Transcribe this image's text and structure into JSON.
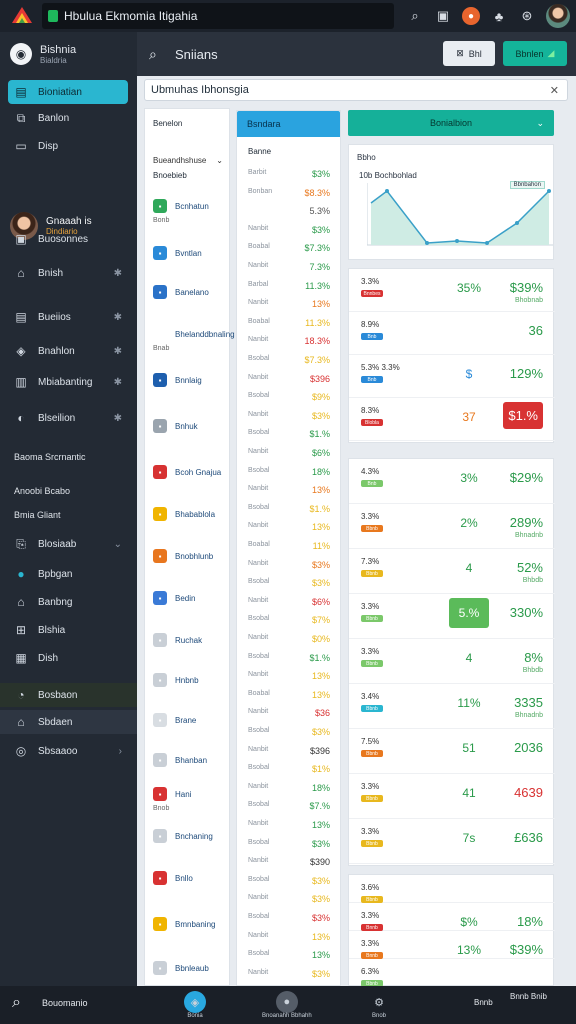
{
  "app": {
    "title": "Hbulua Ekmomia Itigahia"
  },
  "topbar": {
    "icons": [
      "search-icon",
      "calendar-icon",
      "orange-notification-icon",
      "tree-icon",
      "globe-icon"
    ]
  },
  "sidebar": {
    "brand_title": "Bishnia",
    "brand_sub": "Bialdria",
    "nav": [
      {
        "label": "Bioniatian",
        "icon": "dashboard-icon",
        "active": true
      },
      {
        "label": "Banlon",
        "icon": "book-icon"
      },
      {
        "label": "Disp",
        "icon": "card-icon"
      }
    ],
    "profile": {
      "name": "Gnaaah is",
      "status": "Dindiario"
    },
    "items": [
      {
        "label": "Buosonnes",
        "icon": "briefcase-icon"
      },
      {
        "label": "Bnish",
        "icon": "home-icon",
        "extra": "✱"
      },
      {
        "label": "Bueiios",
        "icon": "table-icon",
        "extra": "✱"
      },
      {
        "label": "Bnahlon",
        "icon": "tag-icon",
        "extra": "✱"
      },
      {
        "label": "Mbiabanting",
        "icon": "chart-icon",
        "extra": "✱"
      },
      {
        "label": "Blseilion",
        "icon": "shield-icon",
        "extra": "✱"
      }
    ],
    "section1": "Baoma Srcrnantic",
    "section2": "Anoobi Bcabo",
    "section3": "Bmia Gliant",
    "items2": [
      {
        "label": "Blosiaab",
        "icon": "doc-icon",
        "extra": "⌄"
      },
      {
        "label": "Bpbgan",
        "icon": "globe-icon"
      },
      {
        "label": "Banbng",
        "icon": "house-icon"
      },
      {
        "label": "Blshia",
        "icon": "gift-icon"
      },
      {
        "label": "Dish",
        "icon": "calc-icon"
      }
    ],
    "items3": [
      {
        "label": "Bosbaon",
        "icon": "refresh-icon"
      },
      {
        "label": "Sbdaen",
        "icon": "user-icon"
      },
      {
        "label": "Sbsaaoo",
        "icon": "settings-icon",
        "extra": "›"
      }
    ]
  },
  "header": {
    "search_label": "Sniians",
    "btn1": "Bhl",
    "btn2": "Bbnlen"
  },
  "main": {
    "address": "Ubmuhas Ibhonsgia",
    "col1": {
      "header": "Benelon",
      "dropdown": "Bueandhshuse",
      "sub": "Bnoebieb",
      "items": [
        {
          "label": "Bcnhatun",
          "color": "#2fa85a",
          "sub": "Bonb"
        },
        {
          "label": "Bvntlan",
          "color": "#2a8ad8"
        },
        {
          "label": "Banelano",
          "color": "#2a72c8"
        },
        {
          "label": "Bhelanddbnaling",
          "color": "",
          "sub": "Bnab"
        },
        {
          "label": "Bnnlaig",
          "color": "#1e5fae"
        },
        {
          "label": "Bnhuk",
          "color": "#9aa4ae"
        },
        {
          "label": "Bcoh Gnajua",
          "color": "#d73232"
        },
        {
          "label": "Bhabablola",
          "color": "#f0b400"
        },
        {
          "label": "Bnobhlunb",
          "color": "#e8761e"
        },
        {
          "label": "Bedin",
          "color": "#3a7ad6"
        },
        {
          "label": "Ruchak",
          "color": "#c9cfd6"
        },
        {
          "label": "Hnbnb",
          "color": "#c9cfd6"
        },
        {
          "label": "Brane",
          "color": "#d8dde2"
        },
        {
          "label": "Bhanban",
          "color": "#c9cfd6"
        },
        {
          "label": "Hani",
          "color": "#d83232",
          "sub": "Bnob"
        },
        {
          "label": "Bnchaning",
          "color": "#c9cfd6"
        },
        {
          "label": "Bnllo",
          "color": "#d83232"
        },
        {
          "label": "Bmnbaning",
          "color": "#f0b400"
        },
        {
          "label": "Bbnleaub",
          "color": "#c9cfd6"
        }
      ]
    },
    "col2": {
      "header": "Bsndara",
      "subhead": "Banne",
      "rows": [
        [
          "Barbit",
          "$3%",
          "#2a9a4a"
        ],
        [
          "Bonban",
          "$8.3%",
          "#e8781e"
        ],
        [
          "",
          "5.3%",
          "#555"
        ],
        [
          "Nanbit",
          "$3%",
          "#2a9a4a"
        ],
        [
          "Boabal",
          "$7.3%",
          "#2a9a4a"
        ],
        [
          "Nanbit",
          "7.3%",
          "#2a9a4a"
        ],
        [
          "Barbal",
          "11.3%",
          "#2a9a4a"
        ],
        [
          "Nanbit",
          "13%",
          "#e8781e"
        ],
        [
          "Boabal",
          "11.3%",
          "#e8b81e"
        ],
        [
          "Nanbit",
          "18.3%",
          "#d83232"
        ],
        [
          "Bsobal",
          "$7.3%",
          "#e8b81e"
        ],
        [
          "Nanbit",
          "$396",
          "#d83232"
        ],
        [
          "Bsobal",
          "$9%",
          "#e8b81e"
        ],
        [
          "Nanbit",
          "$3%",
          "#e8b81e"
        ],
        [
          "Bsobal",
          "$1.%",
          "#2a9a4a"
        ],
        [
          "Nanbit",
          "$6%",
          "#2a9a4a"
        ],
        [
          "Bsobal",
          "18%",
          "#2a9a4a"
        ],
        [
          "Nanbit",
          "13%",
          "#e8781e"
        ],
        [
          "Bsobal",
          "$1.%",
          "#e8b81e"
        ],
        [
          "Nanbit",
          "13%",
          "#e8b81e"
        ],
        [
          "Boabal",
          "11%",
          "#e8b81e"
        ],
        [
          "Nanbit",
          "$3%",
          "#e8781e"
        ],
        [
          "Bsobal",
          "$3%",
          "#e8b81e"
        ],
        [
          "Nanbit",
          "$6%",
          "#d83232"
        ],
        [
          "Bsobal",
          "$7%",
          "#e8b81e"
        ],
        [
          "Nanbit",
          "$0%",
          "#e8b81e"
        ],
        [
          "Bsobal",
          "$1.%",
          "#2a9a4a"
        ],
        [
          "Nanbit",
          "13%",
          "#e8b81e"
        ],
        [
          "Boabal",
          "13%",
          "#e8b81e"
        ],
        [
          "Nanbit",
          "$36",
          "#d83232"
        ],
        [
          "Bsobal",
          "$3%",
          "#e8b81e"
        ],
        [
          "Nanbit",
          "$396",
          "#333"
        ],
        [
          "Bsobal",
          "$1%",
          "#e8b81e"
        ],
        [
          "Nanbit",
          "18%",
          "#2a9a4a"
        ],
        [
          "Bsobal",
          "$7.%",
          "#2a9a4a"
        ],
        [
          "Nanbit",
          "13%",
          "#2a9a4a"
        ],
        [
          "Bsobal",
          "$3%",
          "#2a9a4a"
        ],
        [
          "Nanbit",
          "$390",
          "#333"
        ],
        [
          "Bsobal",
          "$3%",
          "#e8b81e"
        ],
        [
          "Nanbit",
          "$3%",
          "#e8b81e"
        ],
        [
          "Bsobal",
          "$3%",
          "#d83232"
        ],
        [
          "Nanbit",
          "13%",
          "#e8b81e"
        ],
        [
          "Bsobal",
          "13%",
          "#2a9a4a"
        ],
        [
          "Nanbit",
          "$3%",
          "#e8b81e"
        ]
      ]
    },
    "col3": {
      "header": "Bonialbion",
      "chart_label": "Bbho",
      "chart_title": "10b Bochbohlad",
      "legend": "Bbnbahon"
    },
    "panel1": [
      {
        "a": "3.3%",
        "badge": "Bnnbes",
        "bc": "#d83232",
        "m": "35%",
        "mc": "#2a9a4a",
        "r": "$39%",
        "rc": "#2a9a4a",
        "rs": "Bhobnab"
      },
      {
        "a": "8.9%",
        "badge": "Bnb",
        "bc": "#2a8ad8",
        "m": "",
        "mc": "#2a9a4a",
        "r": "36",
        "rc": "#2a9a4a",
        "rs": ""
      },
      {
        "a": "5.3% 3.3%",
        "badge": "Bnb",
        "bc": "#2a8ad8",
        "m": "$",
        "mc": "#2a8ad8",
        "r": "129%",
        "rc": "#2a9a4a",
        "rs": ""
      },
      {
        "a": "8.3%",
        "badge": "Blobla",
        "bc": "#d83232",
        "m": "37",
        "mc": "#e8781e",
        "r": "$1.%",
        "rc": "#fff",
        "box": "#d83232",
        "rs": ""
      }
    ],
    "panel2": [
      {
        "a": "4.3%",
        "badge": "Bnb",
        "bc": "#7bc86a",
        "m": "3%",
        "mc": "#2a9a4a",
        "r": "$29%",
        "rc": "#2a9a4a",
        "rs": ""
      },
      {
        "a": "3.3%",
        "badge": "Bbnb",
        "bc": "#e8781e",
        "m": "2%",
        "mc": "#2a9a4a",
        "r": "289%",
        "rc": "#2a9a4a",
        "rs": "Bhnadnb"
      },
      {
        "a": "7.3%",
        "badge": "Bbnb",
        "bc": "#e8b81e",
        "m": "4",
        "mc": "#2a9a4a",
        "r": "52%",
        "rc": "#2a9a4a",
        "rs": "Bhbdb"
      },
      {
        "a": "3.3%",
        "badge": "Bbnb",
        "bc": "#7bc86a",
        "m": "5.%",
        "mc": "#fff",
        "mbox": "#5bbb5a",
        "r": "330%",
        "rc": "#2a9a4a",
        "rs": ""
      },
      {
        "a": "3.3%",
        "badge": "Bbnb",
        "bc": "#7bc86a",
        "m": "4",
        "mc": "#2a9a4a",
        "r": "8%",
        "rc": "#2a9a4a",
        "rs": "Bhbdb"
      },
      {
        "a": "3.4%",
        "badge": "Bbnb",
        "bc": "#2ab6d0",
        "m": "11%",
        "mc": "#2a9a4a",
        "r": "3335",
        "rc": "#2a9a4a",
        "rs": "Bhnadnb"
      },
      {
        "a": "7.5%",
        "badge": "Bbnb",
        "bc": "#e8781e",
        "m": "51",
        "mc": "#2a9a4a",
        "r": "2036",
        "rc": "#2a9a4a",
        "rs": ""
      },
      {
        "a": "3.3%",
        "badge": "Bbnb",
        "bc": "#e8b81e",
        "m": "41",
        "mc": "#2a9a4a",
        "r": "4639",
        "rc": "#d83232",
        "rs": ""
      },
      {
        "a": "3.3%",
        "badge": "Bbnb",
        "bc": "#e8b81e",
        "m": "7s",
        "mc": "#2a9a4a",
        "r": "£636",
        "rc": "#2a9a4a",
        "rs": ""
      }
    ],
    "panel3": [
      {
        "a": "3.6%",
        "badge": "Bbnb",
        "bc": "#e8b81e",
        "m": "",
        "mc": "#2a9a4a",
        "r": "",
        "rc": "#2a9a4a",
        "rs": ""
      },
      {
        "a": "3.3%",
        "badge": "Bnnb",
        "bc": "#d83232",
        "m": "$%",
        "mc": "#2a9a4a",
        "r": "18%",
        "rc": "#2a9a4a",
        "rs": ""
      },
      {
        "a": "3.3%",
        "badge": "Bnnb",
        "bc": "#e8781e",
        "m": "13%",
        "mc": "#2a9a4a",
        "r": "$39%",
        "rc": "#2a9a4a",
        "rs": ""
      },
      {
        "a": "6.3%",
        "badge": "Bbnb",
        "bc": "#7bc86a",
        "m": "",
        "mc": "#2a9a4a",
        "r": "",
        "rc": "#2a9a4a",
        "rs": ""
      }
    ]
  },
  "bottom": {
    "left_label": "Bouomanio",
    "items": [
      {
        "label": "Bonia",
        "icon": "drop-icon",
        "bg": "#29a8e0"
      },
      {
        "label": "Bnoanahh Bbhahh",
        "icon": "user-icon",
        "bg": "#555d68"
      },
      {
        "label": "Bnob",
        "icon": "gear-icon",
        "bg": "#1a1f27"
      }
    ],
    "right1": "Bnnb",
    "right2": "Bnnb Bnib"
  }
}
